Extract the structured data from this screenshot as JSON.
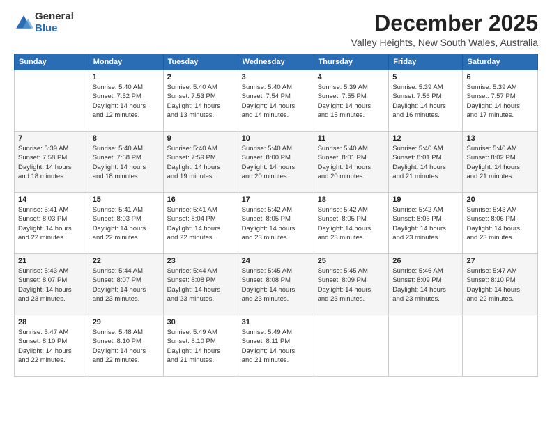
{
  "header": {
    "logo_general": "General",
    "logo_blue": "Blue",
    "month_title": "December 2025",
    "location": "Valley Heights, New South Wales, Australia"
  },
  "days_of_week": [
    "Sunday",
    "Monday",
    "Tuesday",
    "Wednesday",
    "Thursday",
    "Friday",
    "Saturday"
  ],
  "weeks": [
    [
      {
        "day": "",
        "info": ""
      },
      {
        "day": "1",
        "info": "Sunrise: 5:40 AM\nSunset: 7:52 PM\nDaylight: 14 hours\nand 12 minutes."
      },
      {
        "day": "2",
        "info": "Sunrise: 5:40 AM\nSunset: 7:53 PM\nDaylight: 14 hours\nand 13 minutes."
      },
      {
        "day": "3",
        "info": "Sunrise: 5:40 AM\nSunset: 7:54 PM\nDaylight: 14 hours\nand 14 minutes."
      },
      {
        "day": "4",
        "info": "Sunrise: 5:39 AM\nSunset: 7:55 PM\nDaylight: 14 hours\nand 15 minutes."
      },
      {
        "day": "5",
        "info": "Sunrise: 5:39 AM\nSunset: 7:56 PM\nDaylight: 14 hours\nand 16 minutes."
      },
      {
        "day": "6",
        "info": "Sunrise: 5:39 AM\nSunset: 7:57 PM\nDaylight: 14 hours\nand 17 minutes."
      }
    ],
    [
      {
        "day": "7",
        "info": "Sunrise: 5:39 AM\nSunset: 7:58 PM\nDaylight: 14 hours\nand 18 minutes."
      },
      {
        "day": "8",
        "info": "Sunrise: 5:40 AM\nSunset: 7:58 PM\nDaylight: 14 hours\nand 18 minutes."
      },
      {
        "day": "9",
        "info": "Sunrise: 5:40 AM\nSunset: 7:59 PM\nDaylight: 14 hours\nand 19 minutes."
      },
      {
        "day": "10",
        "info": "Sunrise: 5:40 AM\nSunset: 8:00 PM\nDaylight: 14 hours\nand 20 minutes."
      },
      {
        "day": "11",
        "info": "Sunrise: 5:40 AM\nSunset: 8:01 PM\nDaylight: 14 hours\nand 20 minutes."
      },
      {
        "day": "12",
        "info": "Sunrise: 5:40 AM\nSunset: 8:01 PM\nDaylight: 14 hours\nand 21 minutes."
      },
      {
        "day": "13",
        "info": "Sunrise: 5:40 AM\nSunset: 8:02 PM\nDaylight: 14 hours\nand 21 minutes."
      }
    ],
    [
      {
        "day": "14",
        "info": "Sunrise: 5:41 AM\nSunset: 8:03 PM\nDaylight: 14 hours\nand 22 minutes."
      },
      {
        "day": "15",
        "info": "Sunrise: 5:41 AM\nSunset: 8:03 PM\nDaylight: 14 hours\nand 22 minutes."
      },
      {
        "day": "16",
        "info": "Sunrise: 5:41 AM\nSunset: 8:04 PM\nDaylight: 14 hours\nand 22 minutes."
      },
      {
        "day": "17",
        "info": "Sunrise: 5:42 AM\nSunset: 8:05 PM\nDaylight: 14 hours\nand 23 minutes."
      },
      {
        "day": "18",
        "info": "Sunrise: 5:42 AM\nSunset: 8:05 PM\nDaylight: 14 hours\nand 23 minutes."
      },
      {
        "day": "19",
        "info": "Sunrise: 5:42 AM\nSunset: 8:06 PM\nDaylight: 14 hours\nand 23 minutes."
      },
      {
        "day": "20",
        "info": "Sunrise: 5:43 AM\nSunset: 8:06 PM\nDaylight: 14 hours\nand 23 minutes."
      }
    ],
    [
      {
        "day": "21",
        "info": "Sunrise: 5:43 AM\nSunset: 8:07 PM\nDaylight: 14 hours\nand 23 minutes."
      },
      {
        "day": "22",
        "info": "Sunrise: 5:44 AM\nSunset: 8:07 PM\nDaylight: 14 hours\nand 23 minutes."
      },
      {
        "day": "23",
        "info": "Sunrise: 5:44 AM\nSunset: 8:08 PM\nDaylight: 14 hours\nand 23 minutes."
      },
      {
        "day": "24",
        "info": "Sunrise: 5:45 AM\nSunset: 8:08 PM\nDaylight: 14 hours\nand 23 minutes."
      },
      {
        "day": "25",
        "info": "Sunrise: 5:45 AM\nSunset: 8:09 PM\nDaylight: 14 hours\nand 23 minutes."
      },
      {
        "day": "26",
        "info": "Sunrise: 5:46 AM\nSunset: 8:09 PM\nDaylight: 14 hours\nand 23 minutes."
      },
      {
        "day": "27",
        "info": "Sunrise: 5:47 AM\nSunset: 8:10 PM\nDaylight: 14 hours\nand 22 minutes."
      }
    ],
    [
      {
        "day": "28",
        "info": "Sunrise: 5:47 AM\nSunset: 8:10 PM\nDaylight: 14 hours\nand 22 minutes."
      },
      {
        "day": "29",
        "info": "Sunrise: 5:48 AM\nSunset: 8:10 PM\nDaylight: 14 hours\nand 22 minutes."
      },
      {
        "day": "30",
        "info": "Sunrise: 5:49 AM\nSunset: 8:10 PM\nDaylight: 14 hours\nand 21 minutes."
      },
      {
        "day": "31",
        "info": "Sunrise: 5:49 AM\nSunset: 8:11 PM\nDaylight: 14 hours\nand 21 minutes."
      },
      {
        "day": "",
        "info": ""
      },
      {
        "day": "",
        "info": ""
      },
      {
        "day": "",
        "info": ""
      }
    ]
  ]
}
